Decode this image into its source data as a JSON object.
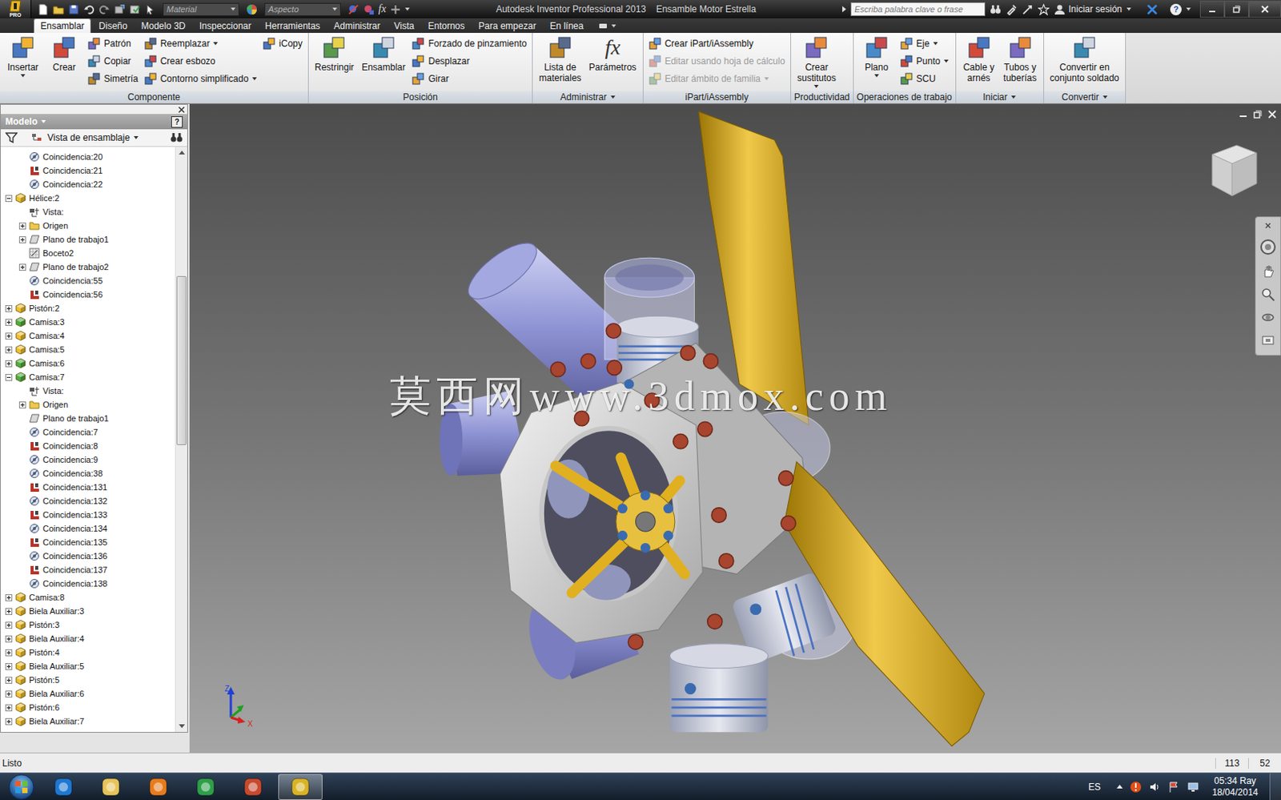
{
  "window": {
    "title": "Autodesk Inventor Professional 2013    Ensamble Motor Estrella",
    "badge": "PRO"
  },
  "quick_access": {
    "material": "Material",
    "appearance": "Aspecto",
    "function": "fx"
  },
  "search": {
    "placeholder": "Escriba palabra clave o frase"
  },
  "account": {
    "label": "Iniciar sesión",
    "help": "?"
  },
  "tabs": [
    {
      "label": "Ensamblar",
      "selected": true
    },
    {
      "label": "Diseño",
      "selected": false
    },
    {
      "label": "Modelo 3D",
      "selected": false
    },
    {
      "label": "Inspeccionar",
      "selected": false
    },
    {
      "label": "Herramientas",
      "selected": false
    },
    {
      "label": "Administrar",
      "selected": false
    },
    {
      "label": "Vista",
      "selected": false
    },
    {
      "label": "Entornos",
      "selected": false
    },
    {
      "label": "Para empezar",
      "selected": false
    },
    {
      "label": "En línea",
      "selected": false
    }
  ],
  "ribbon": {
    "groups": [
      {
        "label": "Componente",
        "menu": false,
        "columns": [
          {
            "kind": "large",
            "lines": [
              "Insertar"
            ],
            "menu": true,
            "disabled": false
          },
          {
            "kind": "large",
            "lines": [
              "Crear"
            ],
            "menu": false,
            "disabled": false
          },
          {
            "kind": "stack",
            "items": [
              {
                "label": "Patrón",
                "menu": false,
                "disabled": false
              },
              {
                "label": "Copiar",
                "menu": false,
                "disabled": false
              },
              {
                "label": "Simetría",
                "menu": false,
                "disabled": false
              }
            ]
          },
          {
            "kind": "stack",
            "items": [
              {
                "label": "Reemplazar",
                "menu": true,
                "disabled": false
              },
              {
                "label": "Crear esbozo",
                "menu": false,
                "disabled": false
              },
              {
                "label": "Contorno simplificado",
                "menu": true,
                "disabled": false
              }
            ]
          },
          {
            "kind": "stack",
            "items": [
              {
                "label": "iCopy",
                "menu": false,
                "disabled": false
              }
            ]
          }
        ]
      },
      {
        "label": "Posición",
        "menu": false,
        "columns": [
          {
            "kind": "large",
            "lines": [
              "Restringir"
            ],
            "menu": false,
            "disabled": false
          },
          {
            "kind": "large",
            "lines": [
              "Ensamblar"
            ],
            "menu": false,
            "disabled": false
          },
          {
            "kind": "stack",
            "items": [
              {
                "label": "Forzado de pinzamiento",
                "menu": false,
                "disabled": false
              },
              {
                "label": "Desplazar",
                "menu": false,
                "disabled": false
              },
              {
                "label": "Girar",
                "menu": false,
                "disabled": false
              }
            ]
          }
        ]
      },
      {
        "label": "Administrar",
        "menu": true,
        "columns": [
          {
            "kind": "large",
            "lines": [
              "Lista de",
              "materiales"
            ],
            "menu": false,
            "disabled": false
          },
          {
            "kind": "large",
            "lines": [
              "Parámetros"
            ],
            "menu": false,
            "disabled": false,
            "glyph": "fx"
          }
        ]
      },
      {
        "label": "iPart/iAssembly",
        "menu": false,
        "columns": [
          {
            "kind": "stack",
            "items": [
              {
                "label": "Crear iPart/iAssembly",
                "menu": false,
                "disabled": false
              },
              {
                "label": "Editar usando hoja de cálculo",
                "menu": false,
                "disabled": true
              },
              {
                "label": "Editar ámbito de familia",
                "menu": true,
                "disabled": true
              }
            ]
          }
        ]
      },
      {
        "label": "Productividad",
        "menu": false,
        "columns": [
          {
            "kind": "large",
            "lines": [
              "Crear",
              "sustitutos"
            ],
            "menu": true,
            "disabled": false
          }
        ]
      },
      {
        "label": "Operaciones de trabajo",
        "menu": false,
        "columns": [
          {
            "kind": "large",
            "lines": [
              "Plano"
            ],
            "menu": true,
            "disabled": false
          },
          {
            "kind": "stack",
            "items": [
              {
                "label": "Eje",
                "menu": true,
                "disabled": false
              },
              {
                "label": "Punto",
                "menu": true,
                "disabled": false
              },
              {
                "label": "SCU",
                "menu": false,
                "disabled": false
              }
            ]
          }
        ]
      },
      {
        "label": "Iniciar",
        "menu": true,
        "columns": [
          {
            "kind": "large",
            "lines": [
              "Cable y",
              "arnés"
            ],
            "menu": false,
            "disabled": false
          },
          {
            "kind": "large",
            "lines": [
              "Tubos y",
              "tuberías"
            ],
            "menu": false,
            "disabled": false
          }
        ]
      },
      {
        "label": "Convertir",
        "menu": true,
        "columns": [
          {
            "kind": "large",
            "lines": [
              "Convertir en",
              "conjunto soldado"
            ],
            "menu": false,
            "disabled": false
          }
        ]
      }
    ]
  },
  "browser": {
    "title": "Modelo",
    "help": "?",
    "view": "Vista de ensamblaje",
    "scrollbar": {
      "offset": 0.21,
      "size": 0.3
    },
    "items": [
      {
        "label": "Coincidencia:20",
        "depth": 1,
        "kind": "mate",
        "expandable": false,
        "expanded": false
      },
      {
        "label": "Coincidencia:21",
        "depth": 1,
        "kind": "flush",
        "expandable": false,
        "expanded": false
      },
      {
        "label": "Coincidencia:22",
        "depth": 1,
        "kind": "mate",
        "expandable": false,
        "expanded": false
      },
      {
        "label": "Hélice:2",
        "depth": 0,
        "kind": "part",
        "color": "#f0c12c",
        "expandable": true,
        "expanded": true
      },
      {
        "label": "Vista:",
        "depth": 1,
        "kind": "view",
        "expandable": false,
        "expanded": false
      },
      {
        "label": "Origen",
        "depth": 1,
        "kind": "folder",
        "expandable": true,
        "expanded": false
      },
      {
        "label": "Plano de trabajo1",
        "depth": 1,
        "kind": "plane",
        "expandable": true,
        "expanded": false
      },
      {
        "label": "Boceto2",
        "depth": 1,
        "kind": "sketch",
        "expandable": false,
        "expanded": false
      },
      {
        "label": "Plano de trabajo2",
        "depth": 1,
        "kind": "plane",
        "expandable": true,
        "expanded": false
      },
      {
        "label": "Coincidencia:55",
        "depth": 1,
        "kind": "mate",
        "expandable": false,
        "expanded": false
      },
      {
        "label": "Coincidencia:56",
        "depth": 1,
        "kind": "flush",
        "expandable": false,
        "expanded": false
      },
      {
        "label": "Pistón:2",
        "depth": 0,
        "kind": "part",
        "color": "#f0c12c",
        "expandable": true,
        "expanded": false
      },
      {
        "label": "Camisa:3",
        "depth": 0,
        "kind": "part",
        "color": "#4caf3c",
        "expandable": true,
        "expanded": false
      },
      {
        "label": "Camisa:4",
        "depth": 0,
        "kind": "part",
        "color": "#f0c12c",
        "expandable": true,
        "expanded": false
      },
      {
        "label": "Camisa:5",
        "depth": 0,
        "kind": "part",
        "color": "#f0c12c",
        "expandable": true,
        "expanded": false
      },
      {
        "label": "Camisa:6",
        "depth": 0,
        "kind": "part",
        "color": "#4caf3c",
        "expandable": true,
        "expanded": false
      },
      {
        "label": "Camisa:7",
        "depth": 0,
        "kind": "part",
        "color": "#4caf3c",
        "expandable": true,
        "expanded": true
      },
      {
        "label": "Vista:",
        "depth": 1,
        "kind": "view",
        "expandable": false,
        "expanded": false
      },
      {
        "label": "Origen",
        "depth": 1,
        "kind": "folder",
        "expandable": true,
        "expanded": false
      },
      {
        "label": "Plano de trabajo1",
        "depth": 1,
        "kind": "plane",
        "expandable": false,
        "expanded": false
      },
      {
        "label": "Coincidencia:7",
        "depth": 1,
        "kind": "mate",
        "expandable": false,
        "expanded": false
      },
      {
        "label": "Coincidencia:8",
        "depth": 1,
        "kind": "flush",
        "expandable": false,
        "expanded": false
      },
      {
        "label": "Coincidencia:9",
        "depth": 1,
        "kind": "mate",
        "expandable": false,
        "expanded": false
      },
      {
        "label": "Coincidencia:38",
        "depth": 1,
        "kind": "mate",
        "expandable": false,
        "expanded": false
      },
      {
        "label": "Coincidencia:131",
        "depth": 1,
        "kind": "flush",
        "expandable": false,
        "expanded": false
      },
      {
        "label": "Coincidencia:132",
        "depth": 1,
        "kind": "mate",
        "expandable": false,
        "expanded": false
      },
      {
        "label": "Coincidencia:133",
        "depth": 1,
        "kind": "flush",
        "expandable": false,
        "expanded": false
      },
      {
        "label": "Coincidencia:134",
        "depth": 1,
        "kind": "mate",
        "expandable": false,
        "expanded": false
      },
      {
        "label": "Coincidencia:135",
        "depth": 1,
        "kind": "flush",
        "expandable": false,
        "expanded": false
      },
      {
        "label": "Coincidencia:136",
        "depth": 1,
        "kind": "mate",
        "expandable": false,
        "expanded": false
      },
      {
        "label": "Coincidencia:137",
        "depth": 1,
        "kind": "flush",
        "expandable": false,
        "expanded": false
      },
      {
        "label": "Coincidencia:138",
        "depth": 1,
        "kind": "mate",
        "expandable": false,
        "expanded": false
      },
      {
        "label": "Camisa:8",
        "depth": 0,
        "kind": "part",
        "color": "#f0c12c",
        "expandable": true,
        "expanded": false
      },
      {
        "label": "Biela Auxiliar:3",
        "depth": 0,
        "kind": "part",
        "color": "#f0c12c",
        "expandable": true,
        "expanded": false
      },
      {
        "label": "Pistón:3",
        "depth": 0,
        "kind": "part",
        "color": "#f0c12c",
        "expandable": true,
        "expanded": false
      },
      {
        "label": "Biela Auxiliar:4",
        "depth": 0,
        "kind": "part",
        "color": "#f0c12c",
        "expandable": true,
        "expanded": false
      },
      {
        "label": "Pistón:4",
        "depth": 0,
        "kind": "part",
        "color": "#f0c12c",
        "expandable": true,
        "expanded": false
      },
      {
        "label": "Biela Auxiliar:5",
        "depth": 0,
        "kind": "part",
        "color": "#f0c12c",
        "expandable": true,
        "expanded": false
      },
      {
        "label": "Pistón:5",
        "depth": 0,
        "kind": "part",
        "color": "#f0c12c",
        "expandable": true,
        "expanded": false
      },
      {
        "label": "Biela Auxiliar:6",
        "depth": 0,
        "kind": "part",
        "color": "#f0c12c",
        "expandable": true,
        "expanded": false
      },
      {
        "label": "Pistón:6",
        "depth": 0,
        "kind": "part",
        "color": "#f0c12c",
        "expandable": true,
        "expanded": false
      },
      {
        "label": "Biela Auxiliar:7",
        "depth": 0,
        "kind": "part",
        "color": "#f0c12c",
        "expandable": true,
        "expanded": false
      }
    ]
  },
  "viewport": {
    "watermark": "莫西网www.3dmox.com",
    "axes": [
      {
        "label": "Z",
        "color": "#1f3fd6"
      },
      {
        "label": "X",
        "color": "#d61f1f"
      }
    ]
  },
  "status_bar": {
    "text": "Listo",
    "cells": [
      "113",
      "52"
    ]
  },
  "taskbar": {
    "apps": [
      {
        "color": "#1e78d2",
        "selected": false
      },
      {
        "color": "#e7c45a",
        "selected": false
      },
      {
        "color": "#e87b1c",
        "selected": false
      },
      {
        "color": "#2f9e4a",
        "selected": false
      },
      {
        "color": "#c74a2e",
        "selected": false
      },
      {
        "color": "#d8b325",
        "selected": true
      }
    ],
    "language": "ES",
    "time": "05:34 Ray",
    "date": "18/04/2014"
  }
}
